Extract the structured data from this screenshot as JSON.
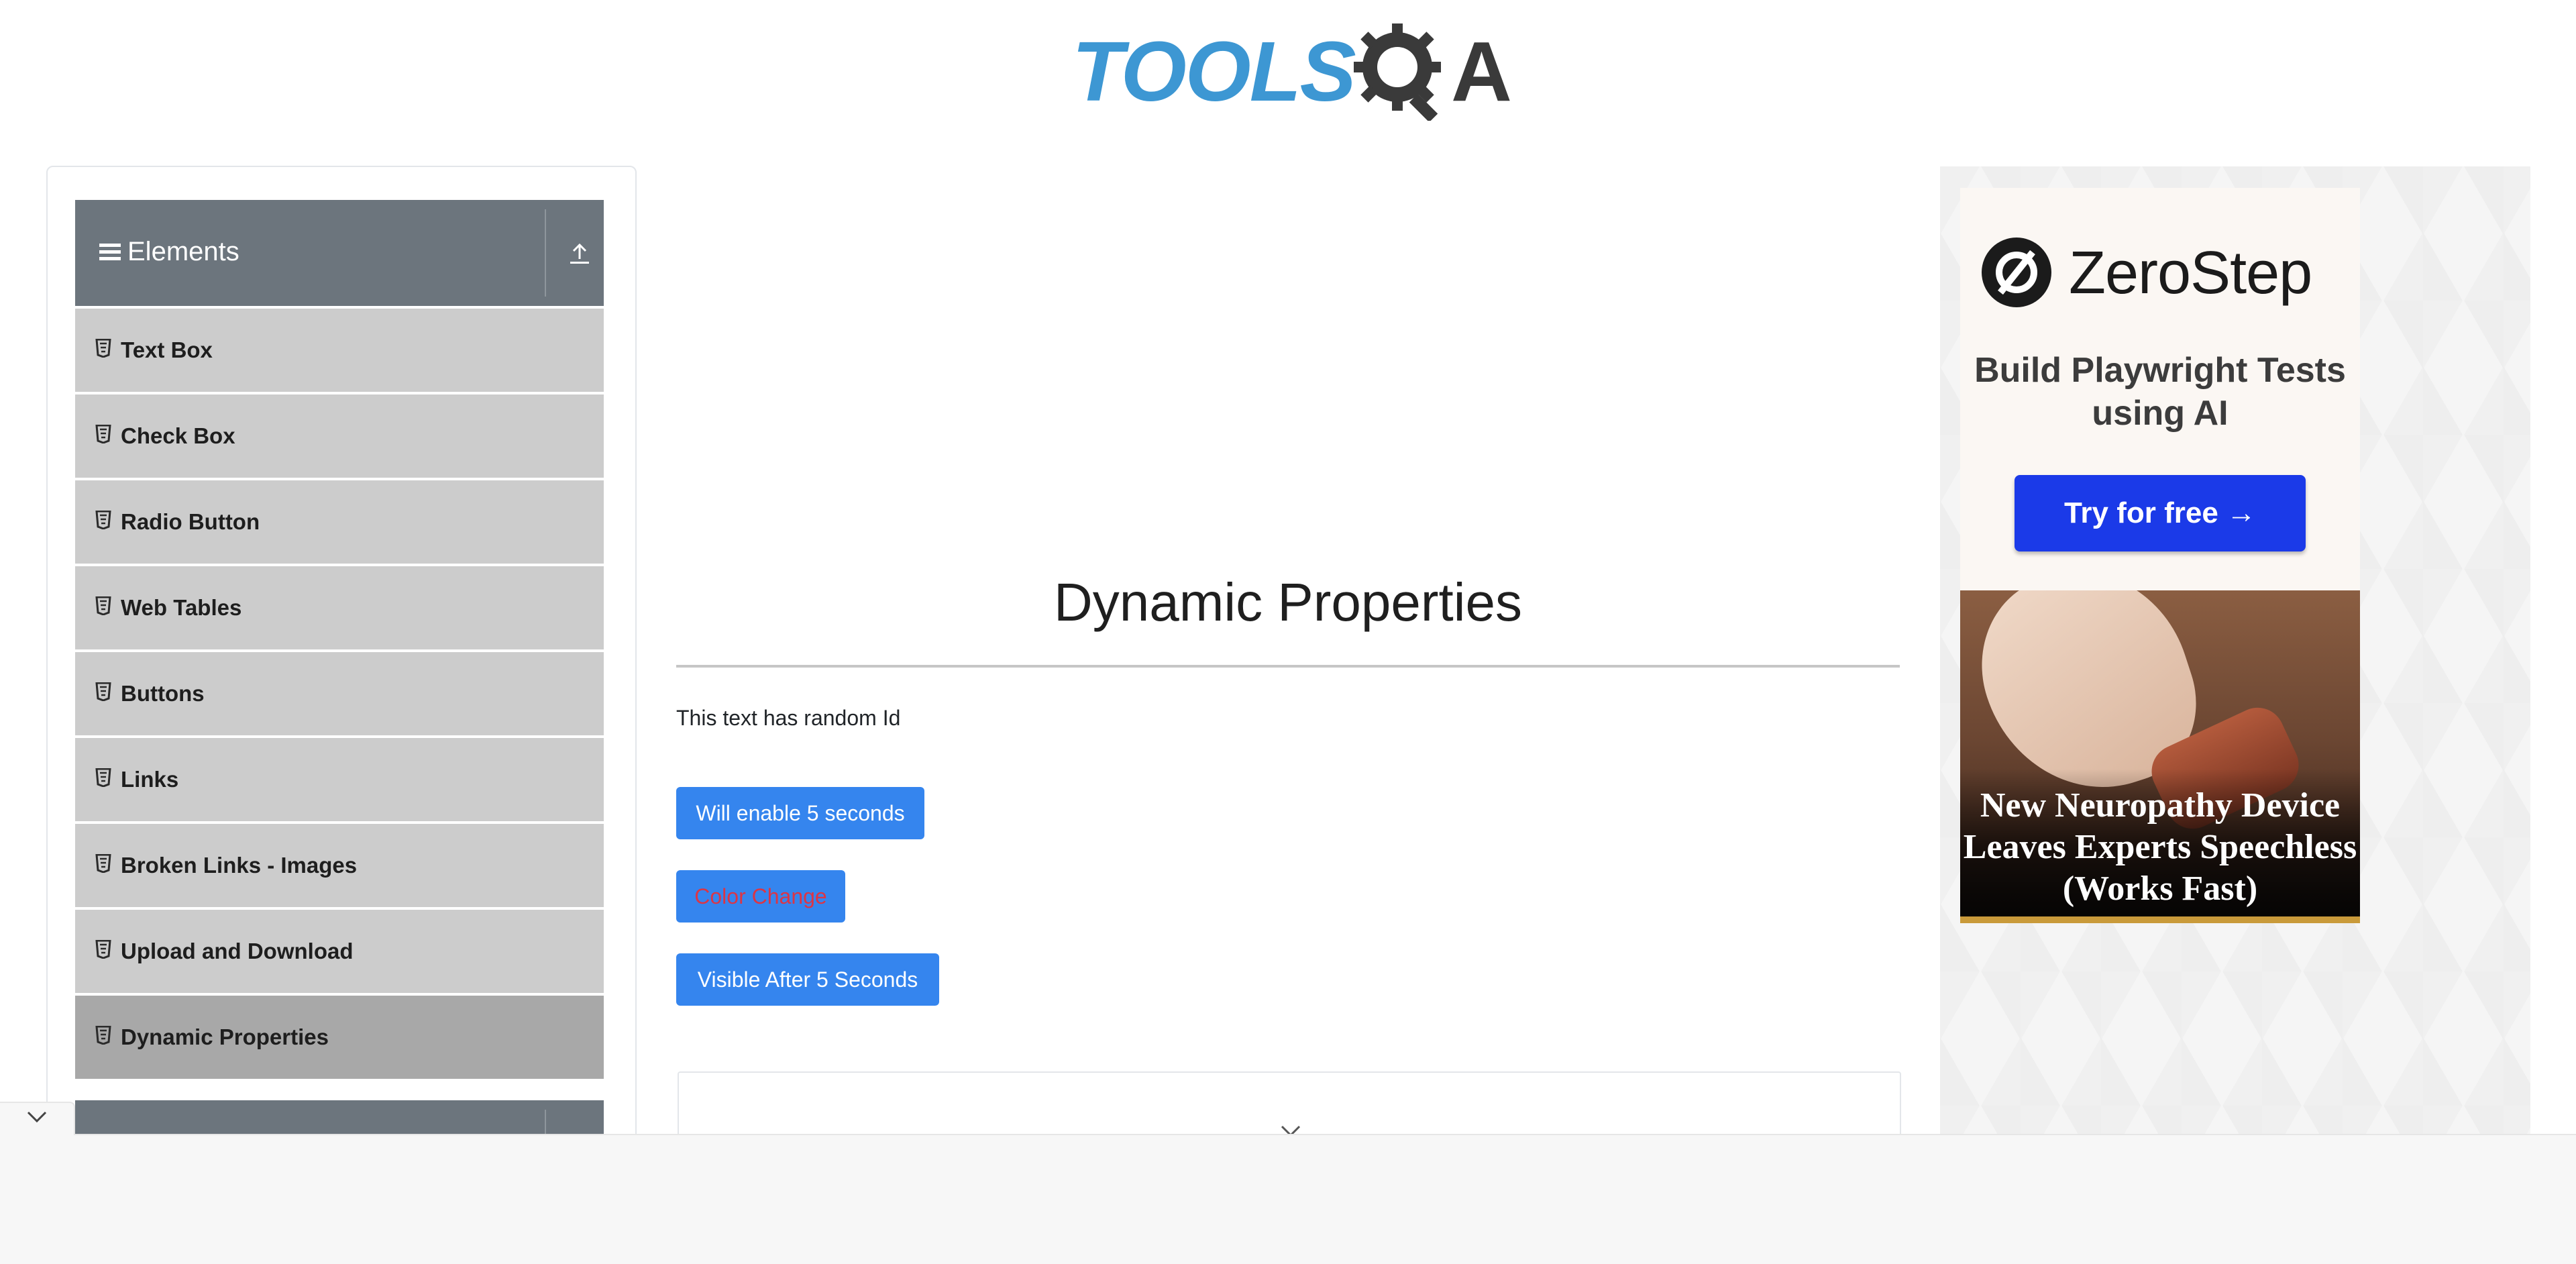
{
  "header": {
    "logo_text": "TOOLS",
    "logo_suffix": "A"
  },
  "sidebar": {
    "group_title": "Elements",
    "items": [
      {
        "label": "Text Box",
        "active": false
      },
      {
        "label": "Check Box",
        "active": false
      },
      {
        "label": "Radio Button",
        "active": false
      },
      {
        "label": "Web Tables",
        "active": false
      },
      {
        "label": "Buttons",
        "active": false
      },
      {
        "label": "Links",
        "active": false
      },
      {
        "label": "Broken Links - Images",
        "active": false
      },
      {
        "label": "Upload and Download",
        "active": false
      },
      {
        "label": "Dynamic Properties",
        "active": true
      }
    ]
  },
  "main": {
    "title": "Dynamic Properties",
    "random_text": "This text has random Id",
    "buttons": {
      "enable": "Will enable 5 seconds",
      "color_change": "Color Change",
      "visible": "Visible After 5 Seconds"
    }
  },
  "ad": {
    "brand": "ZeroStep",
    "tagline": "Build Playwright Tests using AI",
    "cta": "Try for free →",
    "headline": "New Neuropathy Device Leaves Experts Speechless (Works Fast)"
  },
  "colors": {
    "primary_button": "#3585ee",
    "color_change_text": "#dc3545",
    "sidebar_header": "#6c757d",
    "sidebar_item": "#cccccc",
    "sidebar_item_active": "#a8a8a8",
    "logo_blue": "#3d97d3",
    "ad_cta": "#1b3ae8"
  }
}
